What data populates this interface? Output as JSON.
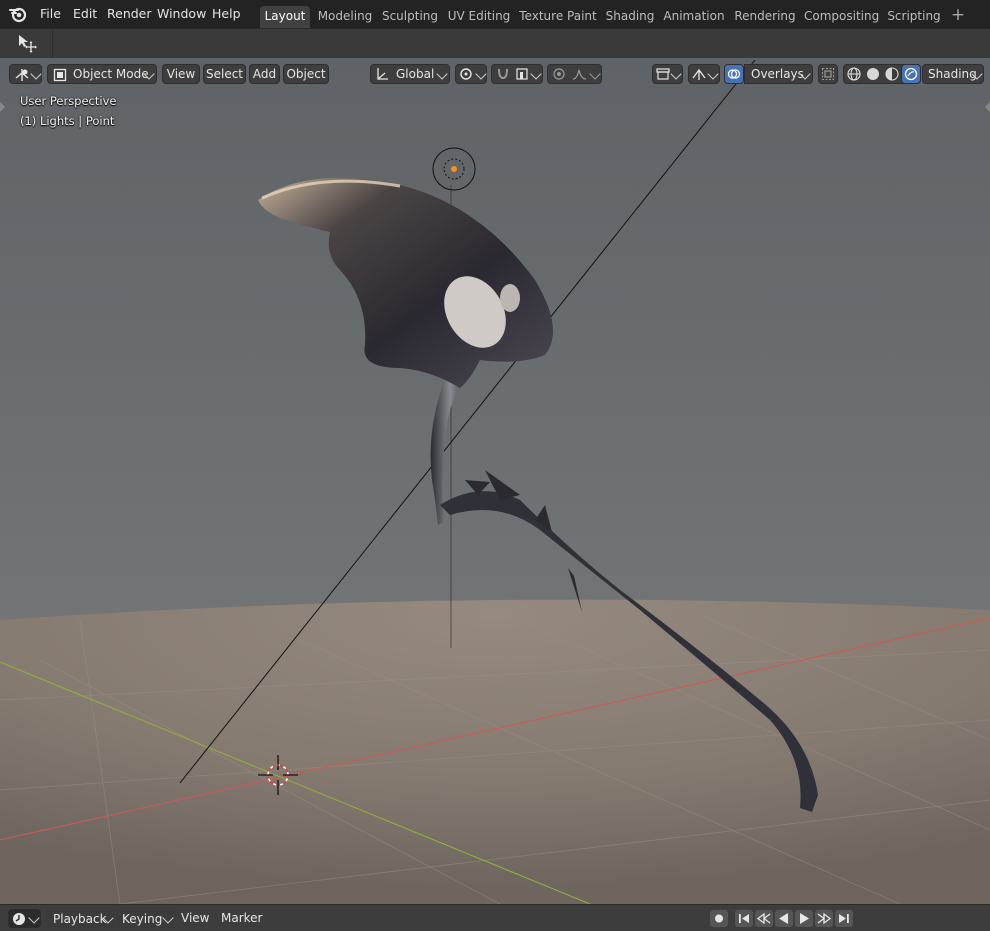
{
  "menu": {
    "file": "File",
    "edit": "Edit",
    "render": "Render",
    "window": "Window",
    "help": "Help"
  },
  "workspaces": [
    "Layout",
    "Modeling",
    "Sculpting",
    "UV Editing",
    "Texture Paint",
    "Shading",
    "Animation",
    "Rendering",
    "Compositing",
    "Scripting"
  ],
  "active_workspace": "Layout",
  "add_workspace_label": "+",
  "header": {
    "mode": "Object Mode",
    "view": "View",
    "select": "Select",
    "add": "Add",
    "object": "Object",
    "transform_orientation": "Global",
    "overlays": "Overlays",
    "shading": "Shading"
  },
  "viewport": {
    "perspective_label": "User Perspective",
    "active_object_label": "(1) Lights | Point"
  },
  "timeline": {
    "playback": "Playback",
    "keying": "Keying",
    "view": "View",
    "marker": "Marker"
  },
  "colors": {
    "accent": "#4772b3",
    "x_axis": "#c85a5a",
    "y_axis": "#8fae3c",
    "background_top": "#5a5e63",
    "floor": "#8a7d72"
  },
  "icons": [
    "blender-logo-icon",
    "select-move-tool-icon",
    "editor-type-icon",
    "object-mode-icon",
    "transform-pivot-icon",
    "snap-icon",
    "proportional-edit-icon",
    "object-type-visibility-icon",
    "show-gizmo-icon",
    "overlays-icon",
    "xray-icon",
    "wireframe-shading-icon",
    "solid-shading-icon",
    "material-preview-shading-icon",
    "rendered-shading-icon",
    "record-icon",
    "jump-start-icon",
    "jump-keyframe-back-icon",
    "play-reverse-icon",
    "play-icon",
    "jump-keyframe-forward-icon",
    "jump-end-icon"
  ]
}
